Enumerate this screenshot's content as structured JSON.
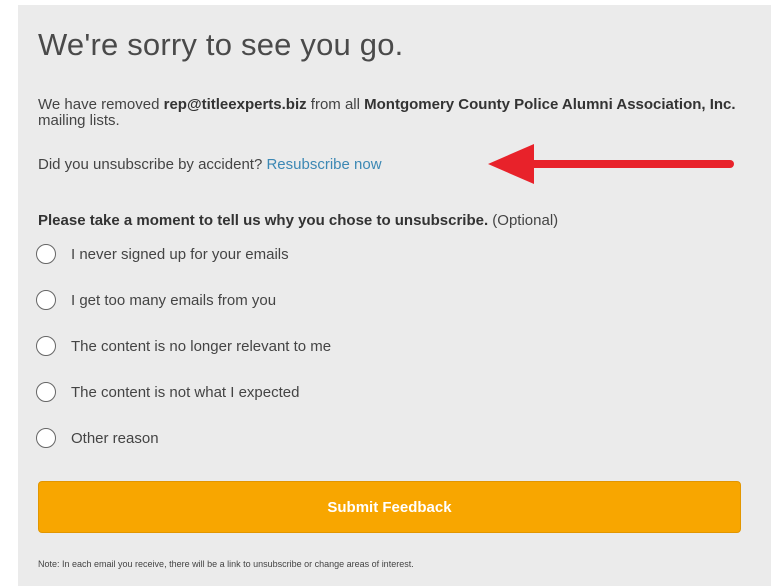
{
  "title": "We're sorry to see you go.",
  "removed": {
    "prefix": "We have removed ",
    "email": "rep@titleexperts.biz",
    "middle": " from all ",
    "org": "Montgomery County Police Alumni Association, Inc.",
    "suffix": " mailing lists."
  },
  "accident": {
    "text": "Did you unsubscribe by accident? ",
    "link": "Resubscribe now"
  },
  "question": {
    "text": "Please take a moment to tell us why you chose to unsubscribe.",
    "optional": " (Optional)"
  },
  "reasons": [
    "I never signed up for your emails",
    "I get too many emails from you",
    "The content is no longer relevant to me",
    "The content is not what I expected",
    "Other reason"
  ],
  "submit_label": "Submit Feedback",
  "note": "Note: In each email you receive, there will be a link to unsubscribe or change areas of interest.",
  "colors": {
    "accent": "#f8a600",
    "link": "#3c88b4",
    "arrow": "#e8222a",
    "background": "#ebebeb"
  }
}
